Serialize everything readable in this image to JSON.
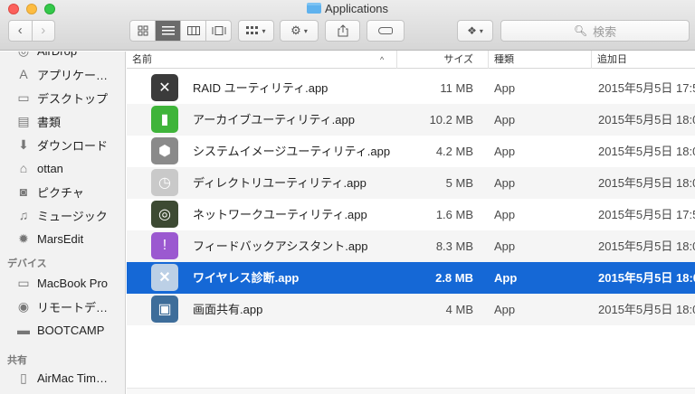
{
  "window": {
    "title": "Applications",
    "folder_icon": "folder-icon"
  },
  "toolbar": {
    "back_icon": "‹",
    "forward_icon": "›",
    "search_placeholder": "検索"
  },
  "sidebar": {
    "items": [
      {
        "label": "AirDrop",
        "icon": "airdrop-icon"
      },
      {
        "label": "アプリケー…",
        "icon": "applications-icon"
      },
      {
        "label": "デスクトップ",
        "icon": "desktop-icon"
      },
      {
        "label": "書類",
        "icon": "documents-icon"
      },
      {
        "label": "ダウンロード",
        "icon": "downloads-icon"
      },
      {
        "label": "ottan",
        "icon": "home-icon"
      },
      {
        "label": "ピクチャ",
        "icon": "pictures-icon"
      },
      {
        "label": "ミュージック",
        "icon": "music-icon"
      },
      {
        "label": "MarsEdit",
        "icon": "marsedit-icon"
      }
    ],
    "devices_heading": "デバイス",
    "devices": [
      {
        "label": "MacBook Pro",
        "icon": "laptop-icon"
      },
      {
        "label": "リモートデ…",
        "icon": "disc-icon"
      },
      {
        "label": "BOOTCAMP",
        "icon": "drive-icon"
      }
    ],
    "shared_heading": "共有",
    "shared": [
      {
        "label": "AirMac Tim…",
        "icon": "airmac-icon"
      }
    ]
  },
  "columns": {
    "name": "名前",
    "size": "サイズ",
    "kind": "種類",
    "date_added": "追加日"
  },
  "files": [
    {
      "name": "RAID ユーティリティ.app",
      "size": "11 MB",
      "kind": "App",
      "date": "2015年5月5日 17:5",
      "icon": "raid-utility-icon",
      "color": "#3b3b3b"
    },
    {
      "name": "アーカイブユーティリティ.app",
      "size": "10.2 MB",
      "kind": "App",
      "date": "2015年5月5日 18:0",
      "icon": "archive-utility-icon",
      "color": "#3fb43a"
    },
    {
      "name": "システムイメージユーティリティ.app",
      "size": "4.2 MB",
      "kind": "App",
      "date": "2015年5月5日 18:0",
      "icon": "system-image-utility-icon",
      "color": "#8a8a8a"
    },
    {
      "name": "ディレクトリユーティリティ.app",
      "size": "5 MB",
      "kind": "App",
      "date": "2015年5月5日 18:0",
      "icon": "directory-utility-icon",
      "color": "#c9c9c9"
    },
    {
      "name": "ネットワークユーティリティ.app",
      "size": "1.6 MB",
      "kind": "App",
      "date": "2015年5月5日 17:5",
      "icon": "network-utility-icon",
      "color": "#3d4a33"
    },
    {
      "name": "フィードバックアシスタント.app",
      "size": "8.3 MB",
      "kind": "App",
      "date": "2015年5月5日 18:0",
      "icon": "feedback-assistant-icon",
      "color": "#9b59d0"
    },
    {
      "name": "ワイヤレス診断.app",
      "size": "2.8 MB",
      "kind": "App",
      "date": "2015年5月5日 18:0",
      "icon": "wireless-diagnostics-icon",
      "color": "#bcd0e6",
      "selected": true
    },
    {
      "name": "画面共有.app",
      "size": "4 MB",
      "kind": "App",
      "date": "2015年5月5日 18:0",
      "icon": "screen-sharing-icon",
      "color": "#3e6d9a"
    }
  ]
}
